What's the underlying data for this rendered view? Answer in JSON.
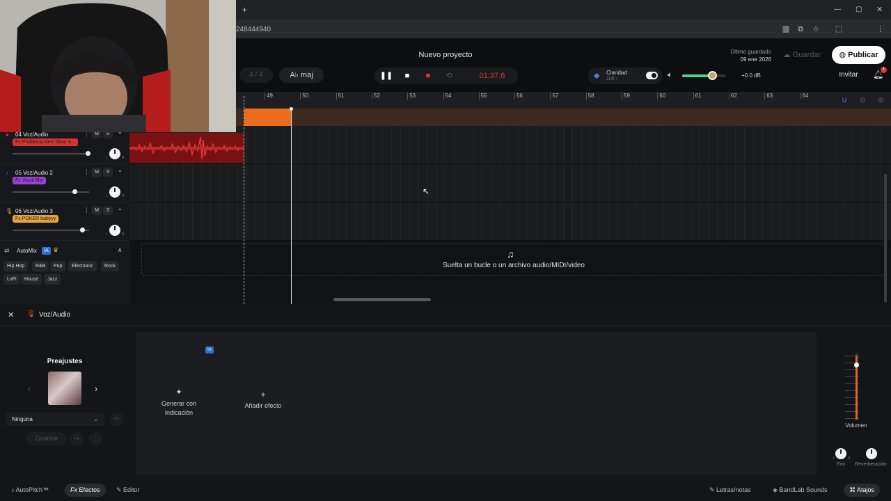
{
  "browser": {
    "new_tab": "+",
    "window_controls": [
      "—",
      "▢",
      "✕"
    ],
    "url_fragment": "248444940",
    "profile_initial": "T"
  },
  "header": {
    "project_title": "Nuevo proyecto",
    "saved_label": "Último guardado",
    "saved_date": "09 ene 2026",
    "save_button": "Guardar",
    "publish_button": "Publicar",
    "bars": "4 / 4",
    "key_button": "A♭ maj",
    "time": "01:37.6",
    "clarity_label": "Claridad",
    "clarity_value": "100 ›",
    "master_volume": 0.7,
    "gain_label": "+0.0 dB",
    "invite_button": "Invitar",
    "notification_count": "1"
  },
  "ruler": {
    "bars": [
      "49",
      "50",
      "51",
      "52",
      "53",
      "54",
      "55",
      "56",
      "57",
      "58",
      "59",
      "60",
      "61",
      "62",
      "63",
      "64"
    ]
  },
  "tracks": [
    {
      "name": "04 Voz/Audio",
      "fx": "Fx Problema New Glow S...",
      "fx_color": "#d73434",
      "volume": 0.95
    },
    {
      "name": "05 Voz/Audio 2",
      "fx": "Fx Vocal Mix",
      "fx_color": "#9b3fd6",
      "volume": 0.78
    },
    {
      "name": "06 Voz/Audio 3",
      "fx": "Fx POKER babyyy",
      "fx_color": "#e8a43a",
      "volume": 0.88
    }
  ],
  "track_buttons": {
    "mute": "M",
    "solo": "S"
  },
  "automix": {
    "title": "AutoMix",
    "ia": "IA",
    "genres": [
      "Hip Hop",
      "R&B",
      "Pop",
      "Electronic",
      "Rock",
      "LoFi",
      "House",
      "Jazz"
    ]
  },
  "drop_zone": {
    "text": "Suelta un bucle o un archivo audio/MIDI/video"
  },
  "bottom_panel": {
    "title": "Voz/Audio",
    "presets_title": "Preajustes",
    "preset_select": "Ninguna",
    "preset_fx": "Fx",
    "save_button": "Guardar",
    "generate_label": "Generar con indicación",
    "generate_ia": "IA",
    "add_effect_label": "Añadir efecto",
    "volume_label": "Volumen",
    "pan_label": "Pan",
    "reverb_label": "Reverberación",
    "lr": [
      "L",
      "R"
    ]
  },
  "bottom_bar": {
    "autopitch": "AutoPitch™",
    "effects": "Efectos",
    "editor": "Editor",
    "lyrics": "Letras/notas",
    "sounds": "BandLab Sounds",
    "shortcuts": "Atajos"
  }
}
